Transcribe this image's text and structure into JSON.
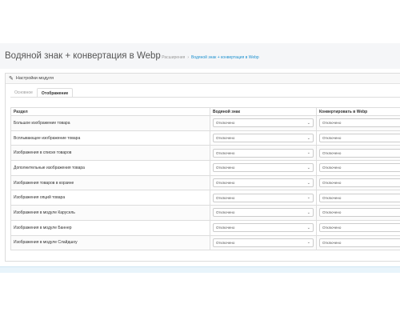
{
  "header": {
    "title": "Водяной знак + конвертация в Webp",
    "breadcrumb": {
      "extensions": "Расширения",
      "current": "Водяной знак + конвертация в Webp"
    }
  },
  "panel": {
    "heading": "Настройки модуля",
    "tabs": [
      {
        "label": "Основное"
      },
      {
        "label": "Отображение"
      }
    ],
    "active_tab": "Отображение"
  },
  "table": {
    "headers": {
      "section": "Раздел",
      "watermark": "Водяной знак",
      "webp": "Конвертировать в Webp"
    },
    "rows": [
      {
        "section": "Большое изображение товара",
        "watermark": "Отключено",
        "webp": "Отключено"
      },
      {
        "section": "Всплывающее изображение товара",
        "watermark": "Отключено",
        "webp": "Отключено"
      },
      {
        "section": "Изображения в списке товаров",
        "watermark": "Отключено",
        "webp": "Отключено"
      },
      {
        "section": "Дополнительные изображения товара",
        "watermark": "Отключено",
        "webp": "Отключено"
      },
      {
        "section": "Изображения товаров в корзине",
        "watermark": "Отключено",
        "webp": "Отключено"
      },
      {
        "section": "Изображения опций товара",
        "watermark": "Отключено",
        "webp": "Отключено"
      },
      {
        "section": "Изображения в модуле Карусель",
        "watermark": "Отключено",
        "webp": "Отключено"
      },
      {
        "section": "Изображения в модуле Баннер",
        "watermark": "Отключено",
        "webp": "Отключено"
      },
      {
        "section": "Изображения в модуле Слайдшоу",
        "watermark": "Отключено",
        "webp": "Отключено"
      }
    ]
  },
  "icons": {
    "home": "home-icon",
    "pencil": "pencil-icon",
    "select_arrow": "chevron-down-icon"
  },
  "colors": {
    "link": "#1e91cf",
    "header_bg": "#f5f6f8",
    "border": "#dddddd"
  }
}
